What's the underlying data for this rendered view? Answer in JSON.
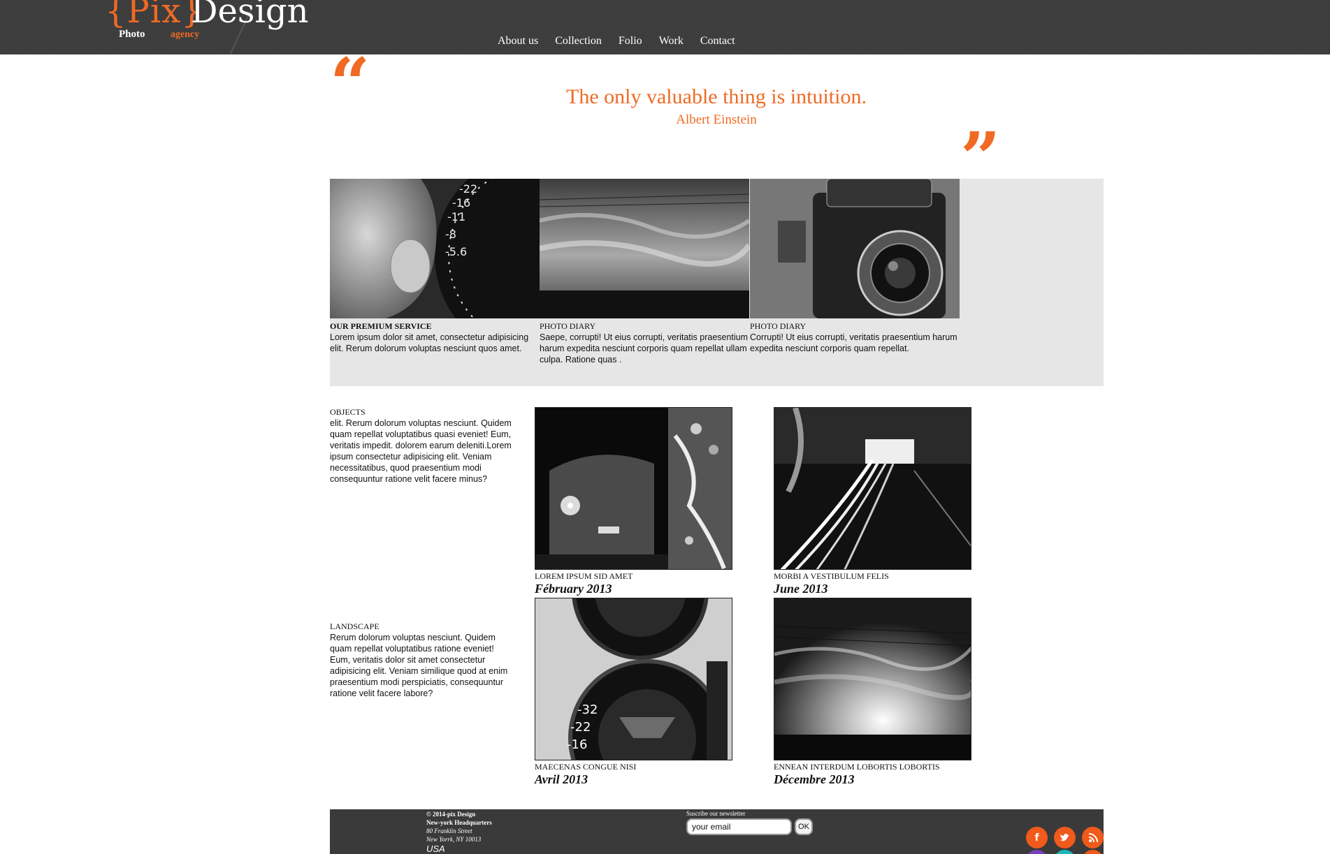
{
  "brand": {
    "braces": "{Pix}",
    "word": "Design",
    "photo": "Photo",
    "agency": "agency",
    "accent": "#f06a23"
  },
  "nav": [
    "About us",
    "Collection",
    "Folio",
    "Work",
    "Contact"
  ],
  "quote": {
    "text": "The only valuable thing is intuition.",
    "author": "Albert Einstein",
    "open_mark": "“",
    "close_mark": "”"
  },
  "features": [
    {
      "title": "OUR PREMIUM SERVICE",
      "body": "Lorem ipsum dolor sit amet, consectetur adipisicing elit. Rerum dolorum voluptas nesciunt quos amet.",
      "image": "camera-lens-finger"
    },
    {
      "title": "PHOTO DIARY",
      "body": "Saepe, corrupti! Ut eius corrupti, veritatis praesentium harum expedita nesciunt corporis quam repellat ullam culpa. Ratione quas .",
      "image": "cloudy-sky"
    },
    {
      "title": "PHOTO DIARY",
      "body": "Corrupti! Ut eius corrupti, veritatis praesentium harum expedita nesciunt corporis quam repellat.",
      "image": "vintage-camera"
    }
  ],
  "sections": [
    {
      "heading": "OBJECTS",
      "body": "elit. Rerum dolorum voluptas nesciunt. Quidem quam repellat voluptatibus quasi eveniet! Eum, veritatis impedit. dolorem earum deleniti.Lorem ipsum consectetur adipisicing elit. Veniam necessitatibus, quod praesentium modi consequuntur ratione velit facere minus?"
    },
    {
      "heading": "LANDSCAPE",
      "body": "Rerum dolorum voluptas nesciunt. Quidem quam repellat voluptatibus ratione eveniet! Eum, veritatis dolor sit amet consectetur adipisicing elit. Veniam similique quod at enim praesentium modi perspiciatis, consequuntur ratione velit facere labore?"
    }
  ],
  "gallery": [
    {
      "caption": "LOREM IPSUM SID AMET",
      "date": "Fébruary 2013",
      "image": "night-building"
    },
    {
      "caption": "MORBI A VESTIBULUM FELIS",
      "date": "June 2013",
      "image": "light-trails"
    },
    {
      "caption": "MAECENAS CONGUE NISI",
      "date": "Avril 2013",
      "image": "twin-lens-camera"
    },
    {
      "caption": "ENNEAN INTERDUM LOBORTIS LOBORTIS",
      "date": "Décembre 2013",
      "image": "sunset-sky"
    }
  ],
  "footer": {
    "copyright": "© 2014-pix Design",
    "hq": "New-york Headquarters",
    "street": "80 Franklin Street",
    "city": "New Yorrk, NY 10013",
    "country": "USA",
    "newsletter_label": "Suscribe our newsletter",
    "email_value": "your email",
    "ok_label": "OK",
    "social": [
      "facebook-icon",
      "twitter-icon",
      "rss-icon"
    ]
  }
}
